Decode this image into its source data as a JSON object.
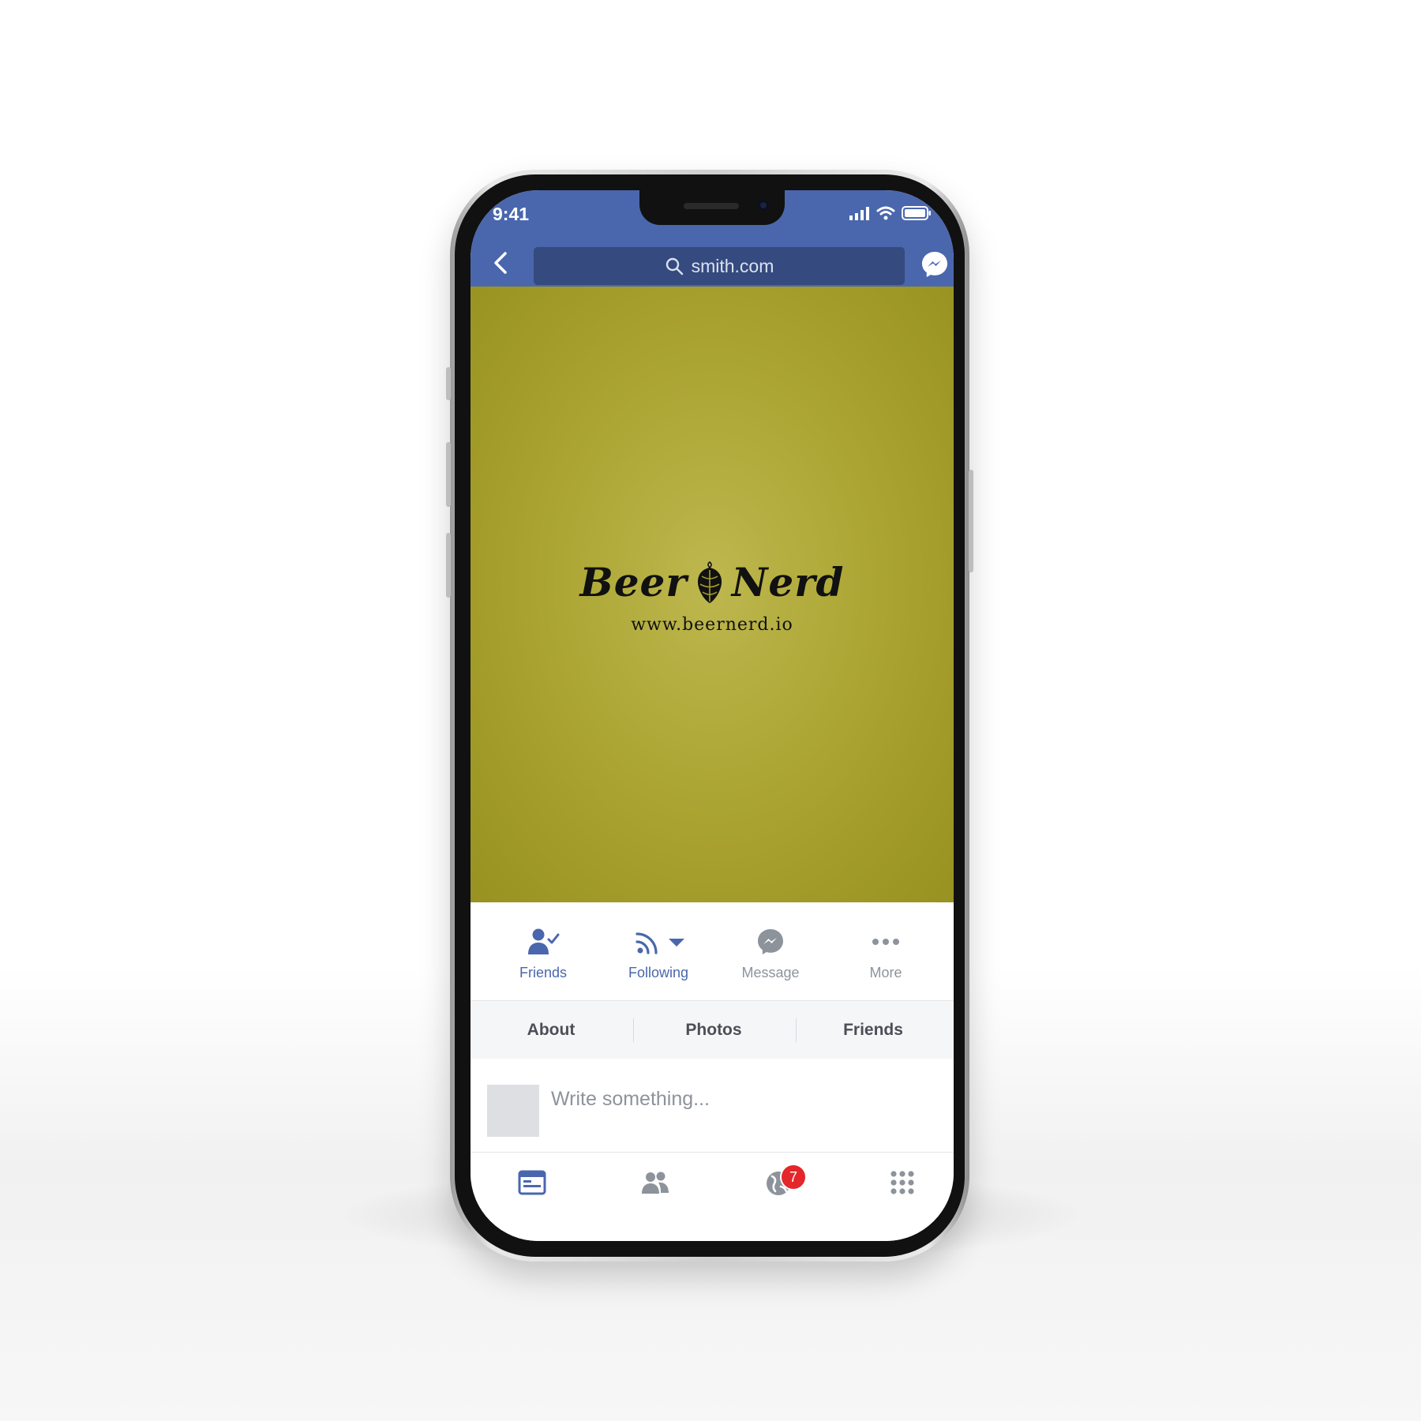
{
  "status_bar": {
    "time": "9:41"
  },
  "nav": {
    "search_text": "smith.com"
  },
  "cover": {
    "brand_left": "Beer",
    "brand_right": "Nerd",
    "url": "www.beernerd.io"
  },
  "actions": [
    {
      "label": "Friends",
      "icon": "friends-check-icon"
    },
    {
      "label": "Following",
      "icon": "rss-icon"
    },
    {
      "label": "Message",
      "icon": "messenger-icon"
    },
    {
      "label": "More",
      "icon": "more-dots-icon"
    }
  ],
  "tabs": [
    {
      "label": "About"
    },
    {
      "label": "Photos"
    },
    {
      "label": "Friends"
    }
  ],
  "composer": {
    "placeholder": "Write something..."
  },
  "tabbar": {
    "notifications_badge": "7"
  },
  "colors": {
    "facebook_blue": "#4a67ad",
    "cover_olive": "#a39c2a",
    "badge_red": "#e4272b"
  }
}
